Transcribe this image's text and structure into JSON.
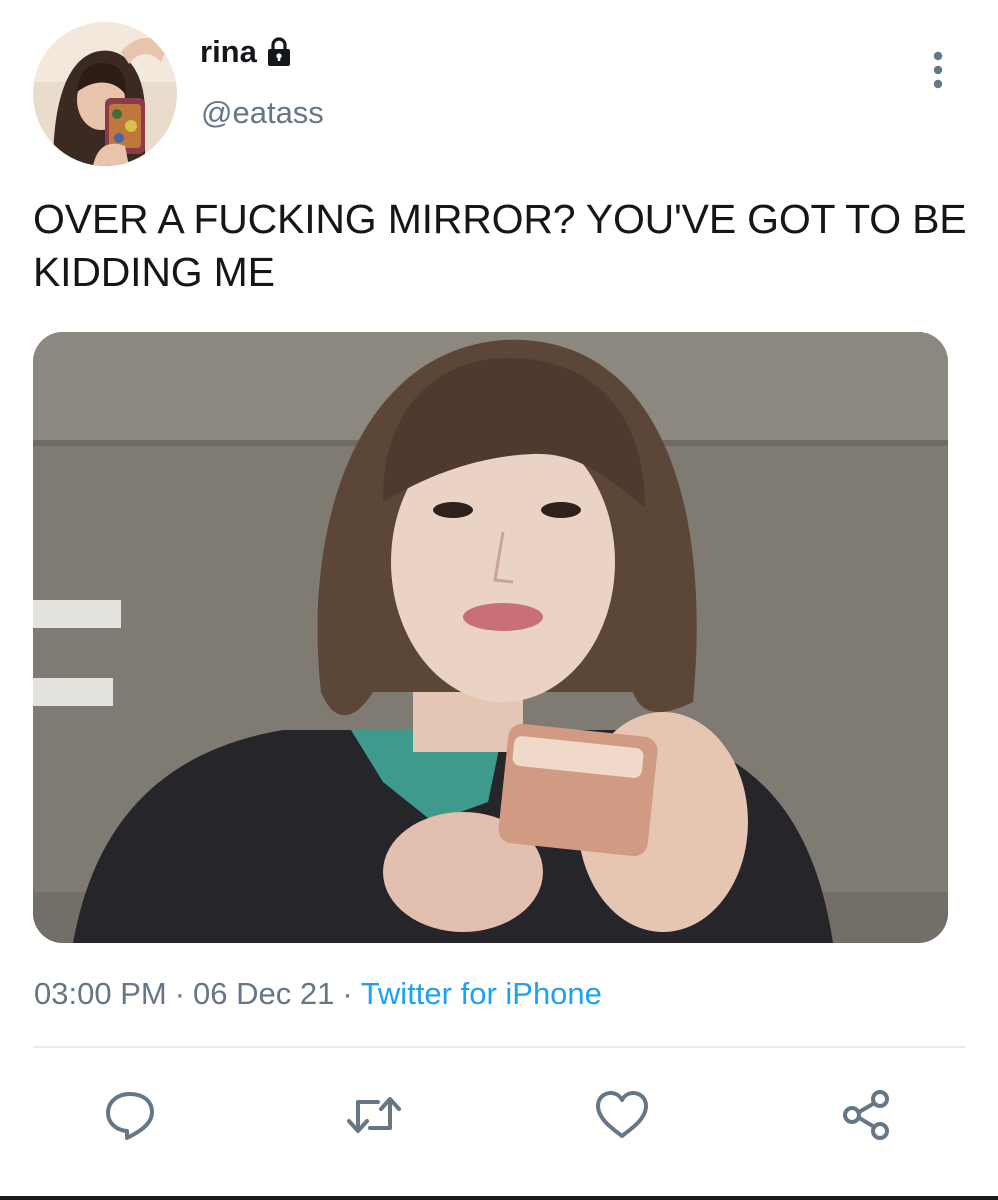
{
  "tweet": {
    "author": {
      "display_name": "rina",
      "handle": "@eatass",
      "protected_icon": "lock-icon",
      "avatar_icon": "profile-avatar"
    },
    "text": "OVER A FUCKING MIRROR? YOU'VE GOT TO BE KIDDING ME",
    "media_icon": "attached-photo",
    "time": "03:00 PM",
    "separator": "·",
    "date": "06 Dec 21",
    "source": "Twitter for iPhone"
  },
  "actions": [
    {
      "icon": "reply-icon"
    },
    {
      "icon": "retweet-icon"
    },
    {
      "icon": "like-icon"
    },
    {
      "icon": "share-icon"
    }
  ],
  "menu_icon": "more-vertical-icon",
  "colors": {
    "text": "#14171a",
    "secondary": "#657786",
    "link": "#1da1f2",
    "divider": "#e6ecf0"
  }
}
